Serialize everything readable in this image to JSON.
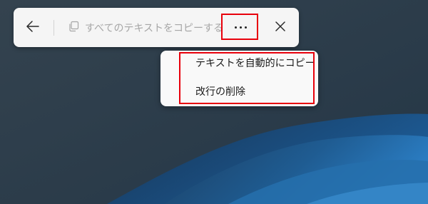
{
  "toolbar": {
    "back_icon": "arrow-left-icon",
    "copy_icon": "copy-icon",
    "copy_all_label": "すべてのテキストをコピーする",
    "more_icon": "more-horizontal-icon",
    "close_icon": "close-icon"
  },
  "menu": {
    "items": [
      {
        "label": "テキストを自動的にコピー"
      },
      {
        "label": "改行の削除"
      }
    ]
  },
  "colors": {
    "highlight": "#e8000b",
    "desktop_bg": "#2b3c4b",
    "wave_blue": "#1c5e9c"
  }
}
